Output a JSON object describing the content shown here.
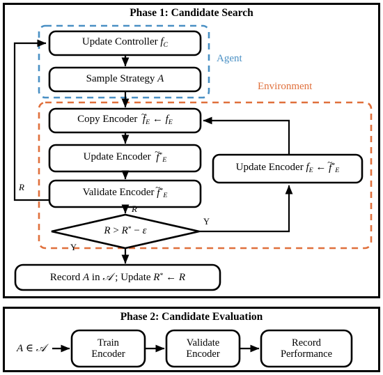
{
  "phase1": {
    "title": "Phase 1: Candidate Search",
    "zones": [
      {
        "name": "Agent",
        "label": "Agent",
        "color": "#4a90c4"
      },
      {
        "name": "Environment",
        "label": "Environment",
        "color": "#e0703c"
      }
    ],
    "nodes": {
      "update_controller": "Update Controller f_C",
      "sample_strategy": "Sample Strategy A",
      "copy_encoder": "Copy Encoder f̃_E ← f_E",
      "update_encoder": "Update Encoder f̃*_E",
      "validate_encoder": "Validate Encoder f̃*_E",
      "update_encoder_back": "Update Encoder f_E ← f̃*_E",
      "record": "Record A in 𝒜 ; Update R* ← R"
    },
    "decision": "R > R* − ε",
    "edge_labels": {
      "reward_left": "R",
      "reward_top": "R",
      "yes_right": "Y",
      "yes_bottom": "Y"
    }
  },
  "phase2": {
    "title": "Phase 2: Candidate Evaluation",
    "input": "A ∈ 𝒜",
    "nodes": [
      {
        "line1": "Train",
        "line2": "Encoder"
      },
      {
        "line1": "Validate",
        "line2": "Encoder"
      },
      {
        "line1": "Record",
        "line2": "Performance"
      }
    ]
  },
  "colors": {
    "agent_dash": "#4a90c4",
    "environment_dash": "#e0703c",
    "stroke": "#000000",
    "background": "#ffffff"
  }
}
